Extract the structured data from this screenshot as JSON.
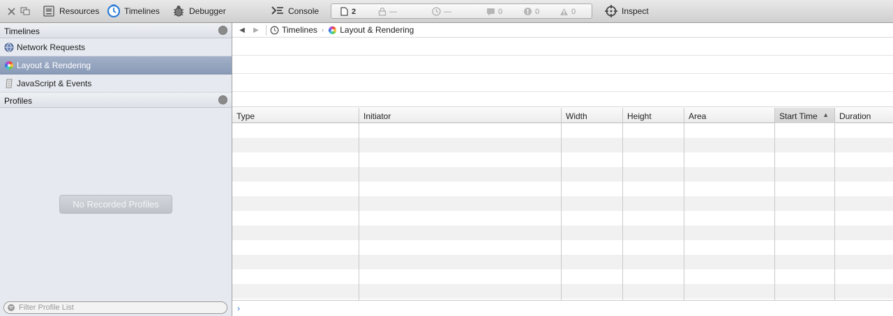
{
  "toolbar": {
    "close_icon": "close-icon",
    "undock_icon": "undock-icon",
    "resources_label": "Resources",
    "timelines_label": "Timelines",
    "debugger_label": "Debugger",
    "console_label": "Console",
    "inspect_label": "Inspect",
    "status": {
      "resources_count": "2",
      "lock_value": "—",
      "time_value": "—",
      "logs_count": "0",
      "errors_count": "0",
      "warnings_count": "0"
    }
  },
  "sidebar": {
    "timelines_header": "Timelines",
    "items": [
      {
        "label": "Network Requests",
        "icon": "globe-icon"
      },
      {
        "label": "Layout & Rendering",
        "icon": "color-wheel-icon"
      },
      {
        "label": "JavaScript & Events",
        "icon": "script-icon"
      }
    ],
    "profiles_header": "Profiles",
    "empty_label": "No Recorded Profiles",
    "filter_placeholder": "Filter Profile List"
  },
  "navbar": {
    "breadcrumb_root": "Timelines",
    "breadcrumb_current": "Layout & Rendering"
  },
  "grid": {
    "columns": [
      "Type",
      "Initiator",
      "Width",
      "Height",
      "Area",
      "Start Time",
      "Duration"
    ],
    "sorted_column": "Start Time",
    "sort_direction": "ascending"
  },
  "console": {
    "prompt": "›"
  },
  "colors": {
    "selected_item": "#8a9bb8",
    "sidebar_bg": "#e6e9ef",
    "accent_blue": "#2b74d6"
  }
}
